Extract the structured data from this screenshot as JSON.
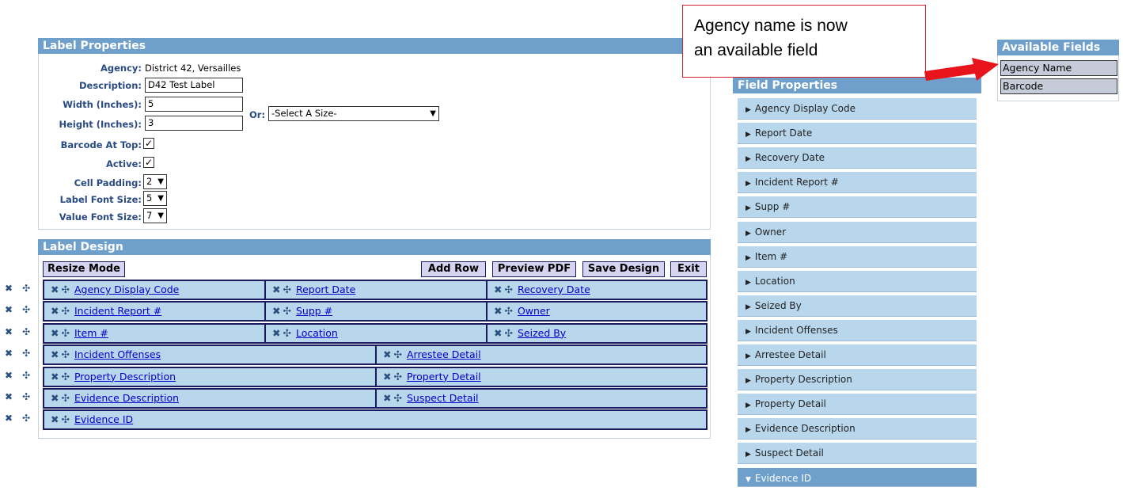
{
  "label_properties": {
    "title": "Label Properties",
    "agency_label": "Agency:",
    "agency_value": "District 42, Versailles",
    "description_label": "Description:",
    "description_value": "D42 Test Label",
    "width_label": "Width (Inches):",
    "width_value": "5",
    "height_label": "Height (Inches):",
    "height_value": "3",
    "or_label": "Or:",
    "size_select": "-Select A Size-",
    "barcode_top_label": "Barcode At Top:",
    "barcode_top_checked": "✓",
    "active_label": "Active:",
    "active_checked": "✓",
    "cell_padding_label": "Cell Padding:",
    "cell_padding_value": "2",
    "label_font_size_label": "Label Font Size:",
    "label_font_size_value": "5",
    "value_font_size_label": "Value Font Size:",
    "value_font_size_value": "7"
  },
  "label_design": {
    "title": "Label Design",
    "resize_mode": "Resize Mode",
    "add_row": "Add Row",
    "preview_pdf": "Preview PDF",
    "save_design": "Save Design",
    "exit": "Exit",
    "rows": [
      [
        "Agency Display Code",
        "Report Date",
        "Recovery Date"
      ],
      [
        "Incident Report #",
        "Supp #",
        "Owner"
      ],
      [
        "Item #",
        "Location",
        "Seized By"
      ],
      [
        "Incident Offenses",
        "Arrestee Detail"
      ],
      [
        "Property Description",
        "Property Detail"
      ],
      [
        "Evidence Description",
        "Suspect Detail"
      ],
      [
        "Evidence ID"
      ]
    ],
    "delete_glyph": "✖",
    "move_glyph": "✣"
  },
  "field_properties": {
    "title": "Field Properties",
    "items": [
      "Agency Display Code",
      "Report Date",
      "Recovery Date",
      "Incident Report #",
      "Supp #",
      "Owner",
      "Item #",
      "Location",
      "Seized By",
      "Incident Offenses",
      "Arrestee Detail",
      "Property Description",
      "Property Detail",
      "Evidence Description",
      "Suspect Detail",
      "Evidence ID"
    ],
    "active_item": "Evidence ID"
  },
  "available_fields": {
    "title": "Available Fields",
    "items": [
      "Agency Name",
      "Barcode"
    ]
  },
  "callout": {
    "line1": "Agency name is now",
    "line2": "an available field"
  },
  "colors": {
    "panel_header": "#6fa0cc",
    "cell_bg": "#b8d6ec",
    "callout_border": "#d2232a",
    "arrow": "#e8141c"
  }
}
